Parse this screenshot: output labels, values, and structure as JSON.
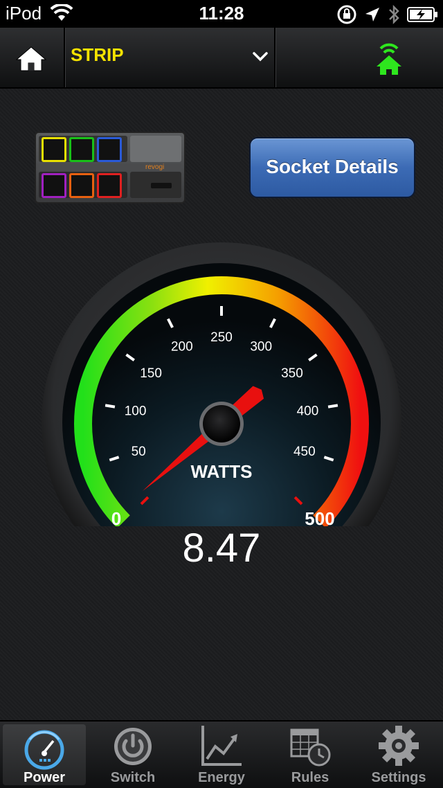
{
  "status_bar": {
    "carrier": "iPod",
    "time": "11:28"
  },
  "nav": {
    "device_name": "STRIP",
    "connection_color": "#2ee61e",
    "device_name_color": "#f5e200"
  },
  "strip": {
    "brand": "revogi",
    "outlet_colors": [
      "#e8e000",
      "#18c018",
      "#2a5ad8",
      "#a020c0",
      "#e86010",
      "#e02020"
    ]
  },
  "socket_details_label": "Socket Details",
  "gauge": {
    "unit_label": "WATTS",
    "min_label": "0",
    "max_label": "500",
    "tick_labels": [
      "50",
      "100",
      "150",
      "200",
      "250",
      "300",
      "350",
      "400",
      "450"
    ],
    "min": 0,
    "max": 500,
    "value": 8.47,
    "reading_text": "8.47"
  },
  "tabs": [
    {
      "label": "Power",
      "icon": "speedometer-icon",
      "active": true
    },
    {
      "label": "Switch",
      "icon": "power-button-icon",
      "active": false
    },
    {
      "label": "Energy",
      "icon": "line-chart-icon",
      "active": false
    },
    {
      "label": "Rules",
      "icon": "calendar-clock-icon",
      "active": false
    },
    {
      "label": "Settings",
      "icon": "gear-icon",
      "active": false
    }
  ]
}
